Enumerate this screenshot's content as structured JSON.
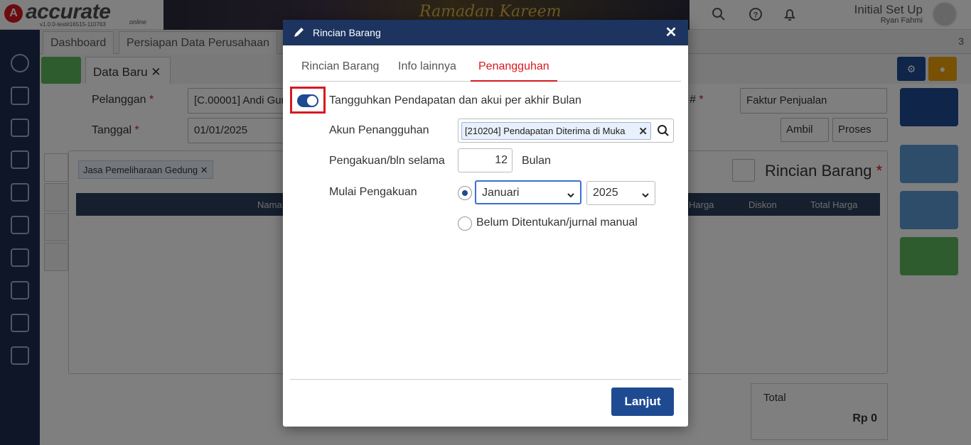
{
  "header": {
    "logo_text": "accurate",
    "logo_version": "v1.0.0-test#16515-110763",
    "logo_online": "online",
    "banner_text": "Ramadan Kareem",
    "user_title": "Initial Set Up",
    "user_name": "Ryan Fahmi"
  },
  "app_tabs": {
    "dashboard": "Dashboard",
    "persiapan": "Persiapan Data Perusahaan",
    "count": "3"
  },
  "form": {
    "tab_label": "Data Baru",
    "pelanggan_label": "Pelanggan",
    "pelanggan_value": "[C.00001] Andi Gunawan",
    "tanggal_label": "Tanggal",
    "tanggal_value": "01/01/2025",
    "no_label": "#",
    "faktur_value": "Faktur Penjualan",
    "ambil_label": "Ambil",
    "proses_label": "Proses",
    "item_chip": "Jasa Pemeliharaan Gedung",
    "rincian_title": "Rincian Barang",
    "col_nama": "Nama",
    "col_harga": "Harga",
    "col_diskon": "Diskon",
    "col_total": "Total Harga",
    "total_label": "Total",
    "total_value": "Rp 0"
  },
  "modal": {
    "title": "Rincian Barang",
    "close_glyph": "✕",
    "tabs": [
      {
        "label": "Rincian Barang",
        "active": false
      },
      {
        "label": "Info lainnya",
        "active": false
      },
      {
        "label": "Penangguhan",
        "active": true
      }
    ],
    "toggle_on": true,
    "toggle_label": "Tangguhkan Pendapatan dan akui per akhir Bulan",
    "akun_label": "Akun Penangguhan",
    "akun_value": "[210204] Pendapatan Diterima di Muka",
    "pengakuan_label": "Pengakuan/bln selama",
    "pengakuan_value": "12",
    "pengakuan_unit": "Bulan",
    "mulai_label": "Mulai Pengakuan",
    "bulan_value": "Januari",
    "tahun_value": "2025",
    "option_manual": "Belum Ditentukan/jurnal manual",
    "selected_option": "periode",
    "submit_label": "Lanjut"
  },
  "colors": {
    "primary": "#1e4a92",
    "header_dark": "#1d3461",
    "active_tab": "#d71920",
    "highlight": "#d71920"
  }
}
